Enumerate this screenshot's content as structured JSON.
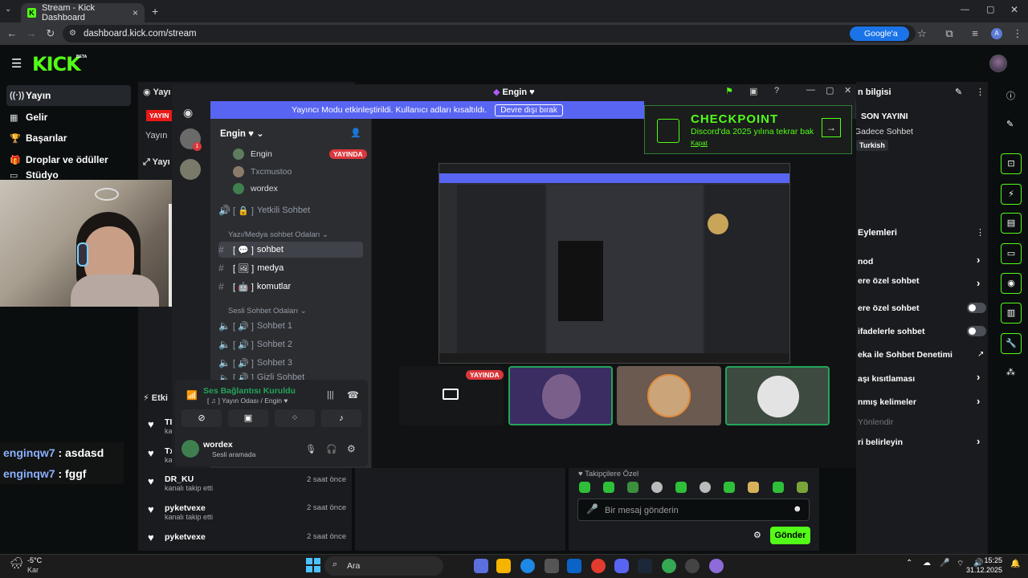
{
  "browser": {
    "tab_title": "Stream - Kick Dashboard",
    "url": "dashboard.kick.com/stream",
    "google_button": "Google'a Sor",
    "profile_letter": "A"
  },
  "kick": {
    "logo": "KICK",
    "beta": "BETA",
    "nav": [
      "Yayın",
      "Gelir",
      "Başarılar",
      "Droplar ve ödüller",
      "Stüdyo"
    ],
    "panel_label_1": "Yayı",
    "panel_tag": "YAYIN",
    "panel_label_2": "Yayın",
    "panel_label_3": "Yayı",
    "events_title": "Etki"
  },
  "chat_overlay": [
    {
      "user": "enginqw7",
      "text": ": asdasd"
    },
    {
      "user": "enginqw7",
      "text": ": fggf"
    }
  ],
  "activity": [
    {
      "name": "TI",
      "sub": "kan",
      "time": ""
    },
    {
      "name": "Tx",
      "sub": "kan",
      "time": ""
    },
    {
      "name": "DR_KU",
      "sub": "kanalı takip etti",
      "time": "2 saat önce"
    },
    {
      "name": "pyketvexe",
      "sub": "kanalı takip etti",
      "time": "2 saat önce"
    },
    {
      "name": "pyketvexe",
      "sub": "kanalı takip etti",
      "time": "2 saat önce"
    }
  ],
  "discord": {
    "window_title": "Engin ♥",
    "banner_text": "Yayıncı Modu etkinleştirildi. Kullanıcı adları kısaltıldı.",
    "banner_button": "Devre dışı bırak",
    "server_name": "Engin ♥",
    "members": [
      "Engin",
      "Txcmustoo",
      "wordex"
    ],
    "live_tag": "YAYINDA",
    "channels": {
      "yetkili": "Yetkili Sohbet",
      "text_category": "Yazı/Medya sohbet Odaları",
      "text": [
        "sohbet",
        "medya",
        "komutlar"
      ],
      "voice_category": "Sesli Sohbet Odaları",
      "voice": [
        "Sohbet 1",
        "Sohbet 2",
        "Sohbet 3",
        "Gizli Sohbet"
      ]
    },
    "voice_status": "Ses Bağlantısı Kuruldu",
    "voice_sub": "[ ♫ ] Yayın Odası / Engin ♥",
    "user": "wordex",
    "user_status": "Sesli aramada",
    "checkpoint": {
      "title": "CHECKPOINT",
      "sub": "Discord'da 2025 yılına tekrar bak",
      "link": "Kapat"
    },
    "tile_live_tag": "YAYINDA"
  },
  "right_panel": {
    "info_title": "n bilgisi",
    "stream_title": "SON YAYINI",
    "category": "Gadece Sohbet",
    "language": "Turkish",
    "actions_title": "Eylemleri",
    "rows": [
      "nod",
      "ere özel sohbet",
      "ere özel sohbet",
      "ifadelerle sohbet",
      "eka ile Sohbet Denetimi",
      "aşı kısıtlaması",
      "nmış kelimeler",
      "Yönlendir",
      "ri belirleyin"
    ]
  },
  "chat_input": {
    "followers_label": "Takipçilere Özel",
    "placeholder": "Bir mesaj gönderin",
    "send": "Gönder"
  },
  "taskbar": {
    "weather_temp": "-5°C",
    "weather_desc": "Kar",
    "search": "Ara",
    "time": "15:25",
    "date": "31.12.2025"
  }
}
